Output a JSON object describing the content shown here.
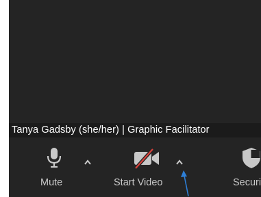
{
  "video": {
    "participant_name": "Tanya Gadsby (she/her) | Graphic Facilitator"
  },
  "toolbar": {
    "mute_label": "Mute",
    "start_video_label": "Start Video",
    "security_label": "Security"
  },
  "icons": {
    "microphone": "microphone-icon",
    "video_off": "video-off-icon",
    "security": "shield-icon",
    "mute_options": "chevron-up-icon",
    "video_options": "chevron-up-icon"
  },
  "colors": {
    "background": "#242424",
    "label": "#c8c8c8",
    "video_off_slash": "#d9413b",
    "annotation_arrow": "#2e7fd6"
  }
}
